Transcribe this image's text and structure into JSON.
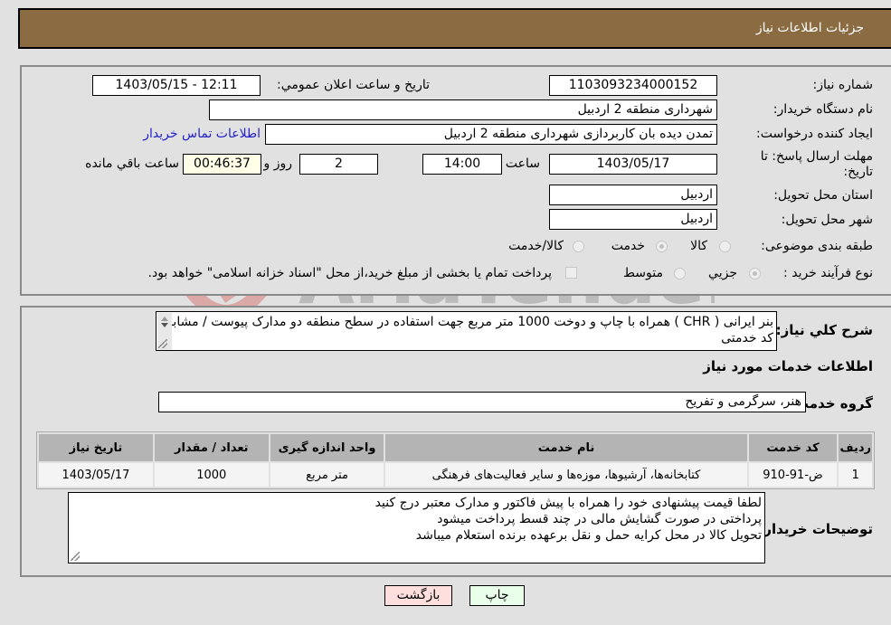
{
  "header": {
    "title": "جزئیات اطلاعات نیاز"
  },
  "form": {
    "need_number_label": "شماره نیاز:",
    "need_number": "1103093234000152",
    "announce_label": "تاریخ و ساعت اعلان عمومي:",
    "announce_value": "1403/05/15 - 12:11",
    "buyer_org_label": "نام دستگاه خریدار:",
    "buyer_org": "شهرداری منطقه 2 اردبیل",
    "creator_label": "ایجاد کننده درخواست:",
    "creator": "تمدن دیده بان کاربردازی شهرداری منطقه 2 اردبیل",
    "buyer_contact_link": "اطلاعات تماس خریدار",
    "deadline_label_1": "مهلت ارسال پاسخ: تا",
    "deadline_label_2": "تاریخ:",
    "deadline_date": "1403/05/17",
    "time_label": "ساعت",
    "deadline_time": "14:00",
    "days_value": "2",
    "days_label": "روز و",
    "remaining_time": "00:46:37",
    "remaining_label": "ساعت باقي مانده",
    "province_label": "استان محل تحویل:",
    "province": "اردبیل",
    "city_label": "شهر محل تحویل:",
    "city": "اردبیل",
    "category_label": "طبقه بندی موضوعی:",
    "category_options": [
      {
        "label": "کالا",
        "checked": false
      },
      {
        "label": "خدمت",
        "checked": true
      },
      {
        "label": "کالا/خدمت",
        "checked": false
      }
    ],
    "process_label": "نوع فرآیند خرید :",
    "process_options": [
      {
        "label": "جزيي",
        "checked": true
      },
      {
        "label": "متوسط",
        "checked": false
      }
    ],
    "treasury_note": "پرداخت تمام یا بخشی از مبلغ خرید،از محل \"اسناد خزانه اسلامی\" خواهد بود."
  },
  "details": {
    "description_label": "شرح کلي نیاز:",
    "description": "بنر ایرانی ( CHR ) همراه با چاپ و دوخت 1000 متر مربع جهت استفاده در سطح منطقه دو مدارک پیوست / مشابه کد خدمتی",
    "services_heading": "اطلاعات خدمات مورد نیاز",
    "service_group_label": "گروه خدمت:",
    "service_group": "هنر، سرگرمی و تفریح",
    "table": {
      "headers": [
        "ردیف",
        "کد خدمت",
        "نام خدمت",
        "واحد اندازه گیری",
        "تعداد / مقدار",
        "تاریخ نیاز"
      ],
      "rows": [
        [
          "1",
          "ض-91-910",
          "کتابخانه‌ها، آرشیوها، موزه‌ها و سایر فعالیت‌های فرهنگی",
          "متر مربع",
          "1000",
          "1403/05/17"
        ]
      ]
    },
    "buyer_notes_label": "توضیحات خریدار:",
    "buyer_notes": [
      "لطفا قیمت پیشنهادی خود را همراه با پیش فاکتور و مدارک معتبر درج کنید",
      "پرداختی در صورت گشایش مالی در چند قسط پرداخت میشود",
      "تحویل کالا در محل کرایه حمل و نقل برعهده برنده استعلام میباشد"
    ]
  },
  "buttons": {
    "print": "چاپ",
    "back": "بازگشت"
  },
  "colors": {
    "header_bg": "#8b6c42",
    "print_bg": "#eaffea",
    "back_bg": "#ffdede",
    "link": "#2222cc"
  }
}
